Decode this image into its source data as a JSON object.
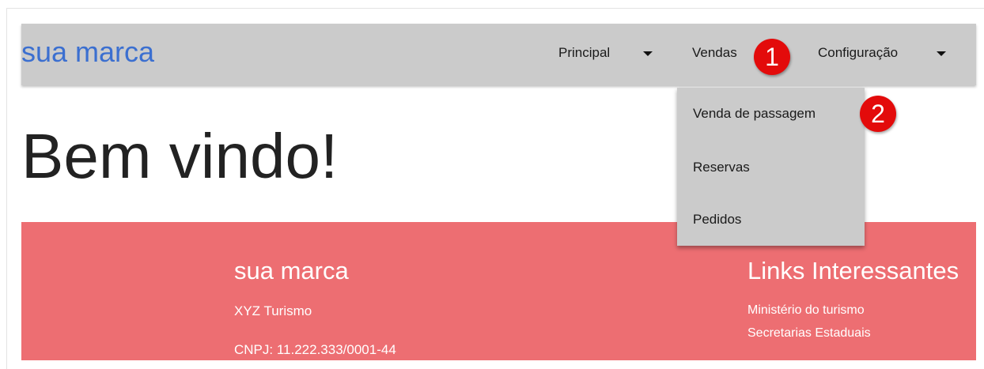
{
  "navbar": {
    "brand": "sua marca",
    "items": [
      {
        "label": "Principal"
      },
      {
        "label": "Vendas"
      },
      {
        "label": "Configuração"
      }
    ]
  },
  "dropdown": {
    "items": [
      {
        "label": "Venda de passagem"
      },
      {
        "label": "Reservas"
      },
      {
        "label": "Pedidos"
      }
    ]
  },
  "annotations": {
    "step1": "1",
    "step2": "2"
  },
  "hero": {
    "title": "Bem vindo!"
  },
  "footer": {
    "brand": "sua marca",
    "company": "XYZ Turismo",
    "cnpj": "CNPJ: 11.222.333/0001-44",
    "links_heading": "Links Interessantes",
    "links": [
      {
        "label": "Ministério do turismo"
      },
      {
        "label": "Secretarias Estaduais"
      }
    ]
  },
  "colors": {
    "navbar_bg": "#cbcbcb",
    "brand_blue": "#3b6fd0",
    "footer_bg": "#ed6e72",
    "badge_red": "#e30b0b"
  }
}
